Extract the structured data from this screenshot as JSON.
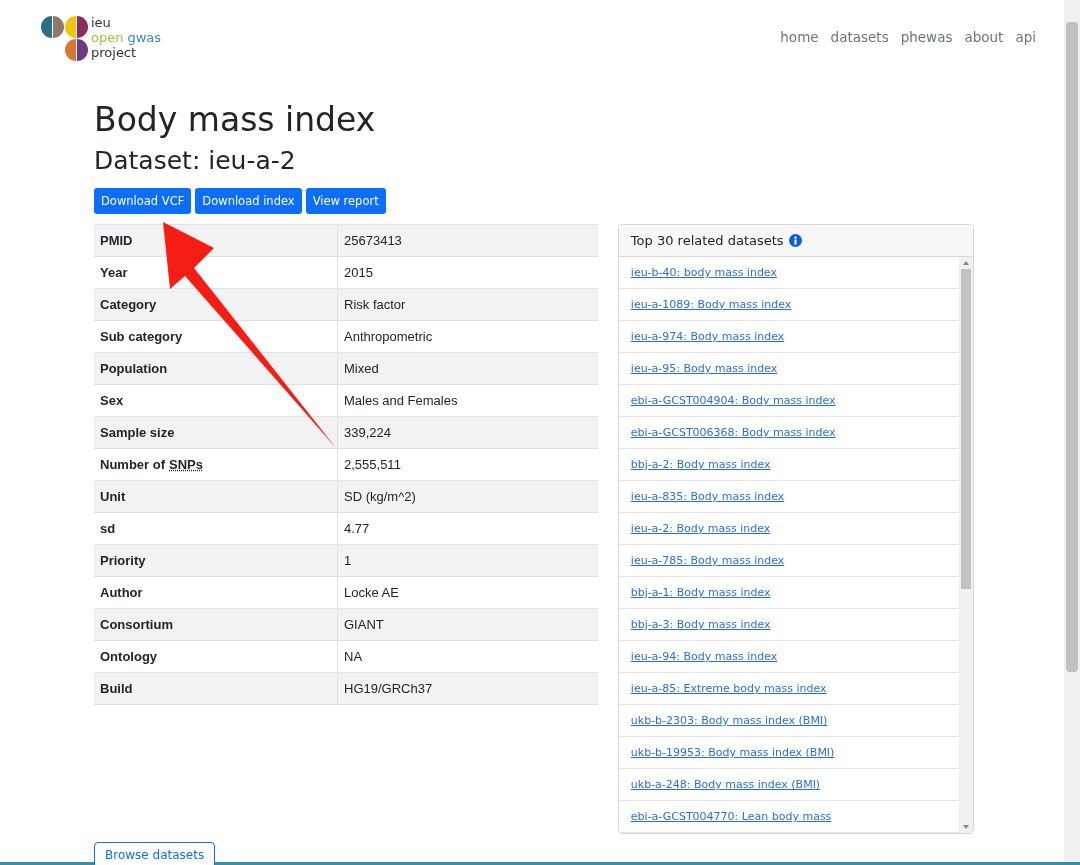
{
  "logo": {
    "line1": "ieu",
    "line2a": "open",
    "line2b": "gwas",
    "line3": "project"
  },
  "nav": [
    {
      "label": "home"
    },
    {
      "label": "datasets"
    },
    {
      "label": "phewas"
    },
    {
      "label": "about"
    },
    {
      "label": "api"
    }
  ],
  "title": "Body mass index",
  "subtitle": "Dataset: ieu-a-2",
  "buttons": [
    "Download VCF",
    "Download index",
    "View report"
  ],
  "table": {
    "rows": [
      {
        "label": "PMID",
        "value": "25673413"
      },
      {
        "label": "Year",
        "value": "2015"
      },
      {
        "label": "Category",
        "value": "Risk factor"
      },
      {
        "label": "Sub category",
        "value": "Anthropometric"
      },
      {
        "label": "Population",
        "value": "Mixed"
      },
      {
        "label": "Sex",
        "value": "Males and Females"
      },
      {
        "label": "Sample size",
        "value": "339,224"
      },
      {
        "label": "Number of",
        "abbr": "SNPs",
        "value": "2,555,511"
      },
      {
        "label": "Unit",
        "value": "SD (kg/m^2)"
      },
      {
        "label": "sd",
        "value": "4.77"
      },
      {
        "label": "Priority",
        "value": "1"
      },
      {
        "label": "Author",
        "value": "Locke AE"
      },
      {
        "label": "Consortium",
        "value": "GIANT"
      },
      {
        "label": "Ontology",
        "value": "NA"
      },
      {
        "label": "Build",
        "value": "HG19/GRCh37"
      }
    ]
  },
  "related": {
    "title": "Top 30 related datasets",
    "items": [
      "ieu-b-40: body mass index",
      "ieu-a-1089: Body mass index",
      "ieu-a-974: Body mass index",
      "ieu-a-95: Body mass index",
      "ebi-a-GCST004904: Body mass index",
      "ebi-a-GCST006368: Body mass index",
      "bbj-a-2: Body mass index",
      "ieu-a-835: Body mass index",
      "ieu-a-2: Body mass index",
      "ieu-a-785: Body mass index",
      "bbj-a-1: Body mass index",
      "bbj-a-3: Body mass index",
      "ieu-a-94: Body mass index",
      "ieu-a-85: Extreme body mass index",
      "ukb-b-2303: Body mass index (BMI)",
      "ukb-b-19953: Body mass index (BMI)",
      "ukb-a-248: Body mass index (BMI)",
      "ebi-a-GCST004770: Lean body mass"
    ]
  },
  "browse_button": "Browse datasets"
}
